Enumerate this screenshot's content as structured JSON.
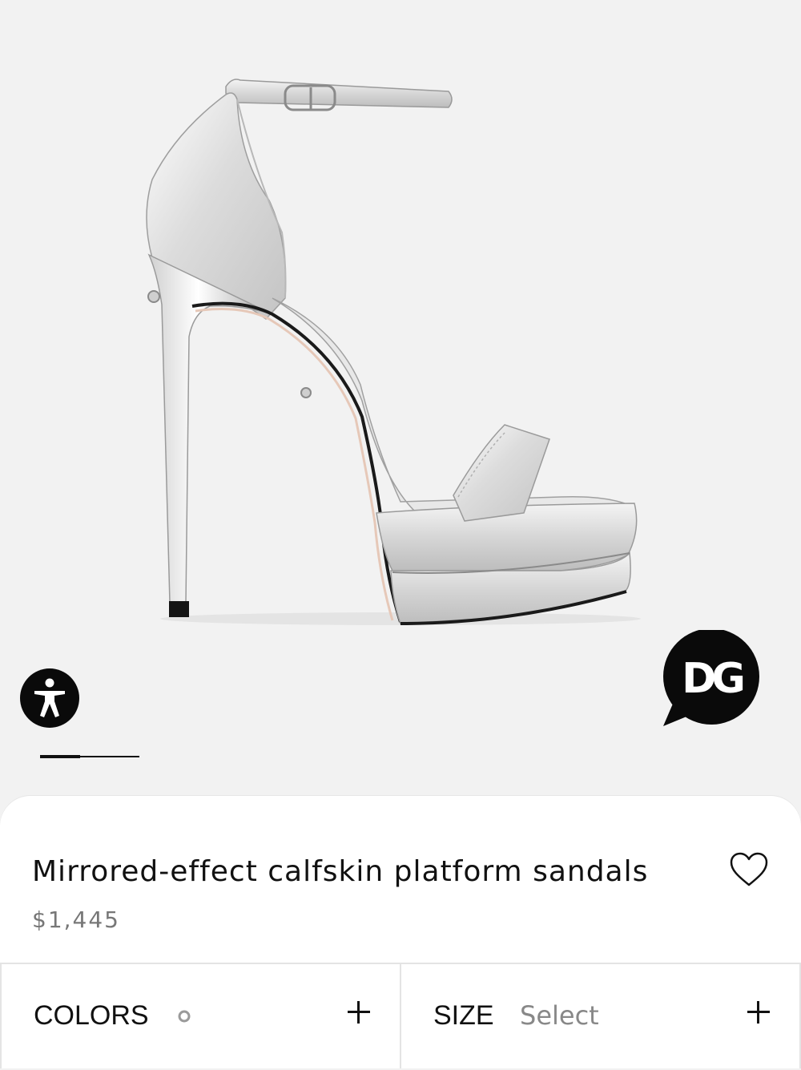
{
  "product": {
    "title": "Mirrored-effect calfskin platform sandals",
    "price": "$1,445",
    "image_subject": "silver mirrored-effect platform sandal with ankle strap and stiletto heel"
  },
  "gallery": {
    "current_index": 1,
    "total": 3
  },
  "icons": {
    "accessibility": "accessibility-icon",
    "brand_chat": "dg-chat-icon",
    "wishlist": "heart-outline-icon",
    "colors_expand": "plus-icon",
    "size_expand": "plus-icon",
    "color_swatch": "dot-icon"
  },
  "brand": {
    "logo_text": "DG"
  },
  "selectors": {
    "colors": {
      "label": "COLORS",
      "swatch_color": "#c8c8c8"
    },
    "size": {
      "label": "SIZE",
      "value": "Select"
    }
  },
  "colors": {
    "background": "#f2f2f2",
    "sheet": "#ffffff",
    "text": "#111111",
    "muted": "#777777",
    "silver": "#d9d9d9"
  }
}
